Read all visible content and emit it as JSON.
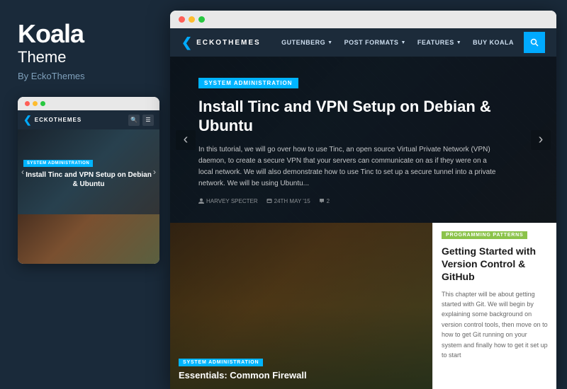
{
  "left": {
    "brand": {
      "title": "Koala",
      "subtitle": "Theme",
      "by": "By EckoThemes"
    },
    "phone": {
      "nav": {
        "brand": "ECKOTHEMES"
      },
      "hero": {
        "badge": "SYSTEM ADMINISTRATION",
        "title": "Install Tinc and VPN Setup on Debian & Ubuntu"
      }
    }
  },
  "browser": {
    "dots": [
      "red",
      "yellow",
      "green"
    ],
    "nav": {
      "brand": "ECKOTHEMES",
      "links": [
        {
          "label": "GUTENBERG",
          "hasDropdown": true
        },
        {
          "label": "POST FORMATS",
          "hasDropdown": true
        },
        {
          "label": "FEATURES",
          "hasDropdown": true
        },
        {
          "label": "BUY KOALA",
          "hasDropdown": false
        }
      ]
    },
    "hero": {
      "badge": "SYSTEM ADMINISTRATION",
      "title": "Install Tinc and VPN Setup on Debian & Ubuntu",
      "text": "In this tutorial, we will go over how to use Tinc, an open source Virtual Private Network (VPN) daemon, to create a secure VPN that your servers can communicate on as if they were on a local network. We will also demonstrate how to use Tinc to set up a secure tunnel into a private network. We will be using Ubuntu...",
      "meta": {
        "author": "HARVEY SPECTER",
        "date": "24TH MAY '15",
        "comments": "2"
      }
    },
    "card_left": {
      "badge": "SYSTEM ADMINISTRATION",
      "title": "Essentials: Common Firewall"
    },
    "card_right": {
      "badge": "PROGRAMMING PATTERNS",
      "title": "Getting Started with Version Control & GitHub",
      "text": "This chapter will be about getting started with Git. We will begin by explaining some background on version control tools, then move on to how to get Git running on your system and finally how to get it set up to start"
    }
  },
  "colors": {
    "accent_blue": "#00b4ff",
    "accent_green": "#8bc34a",
    "nav_bg": "#1c2b3a"
  }
}
